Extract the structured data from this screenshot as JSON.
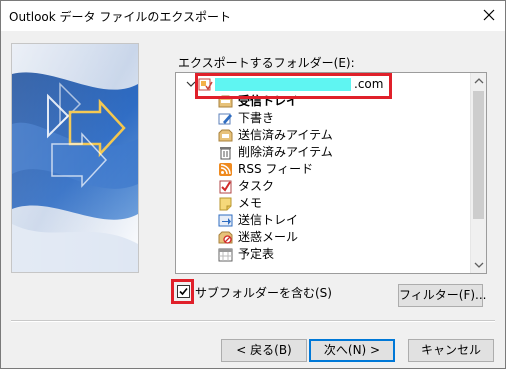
{
  "window": {
    "title": "Outlook データ ファイルのエクスポート"
  },
  "tree": {
    "label": "エクスポートするフォルダー(E):",
    "account_suffix": ".com",
    "items": [
      {
        "label": "受信トレイ",
        "icon": "inbox-icon",
        "bold": true
      },
      {
        "label": "下書き",
        "icon": "drafts-icon",
        "bold": false
      },
      {
        "label": "送信済みアイテム",
        "icon": "sent-items-icon",
        "bold": false
      },
      {
        "label": "削除済みアイテム",
        "icon": "trash-icon",
        "bold": false
      },
      {
        "label": "RSS フィード",
        "icon": "rss-icon",
        "bold": false
      },
      {
        "label": "タスク",
        "icon": "tasks-icon",
        "bold": false
      },
      {
        "label": "メモ",
        "icon": "notes-icon",
        "bold": false
      },
      {
        "label": "送信トレイ",
        "icon": "outbox-icon",
        "bold": false
      },
      {
        "label": "迷惑メール",
        "icon": "junk-mail-icon",
        "bold": false
      },
      {
        "label": "予定表",
        "icon": "calendar-icon",
        "bold": false
      }
    ]
  },
  "options": {
    "include_subfolders_label": "サブフォルダーを含む(S)",
    "include_subfolders_checked": true,
    "filter_button": "フィルター(F)..."
  },
  "footer": {
    "back_button": "< 戻る(B)",
    "next_button": "次へ(N) >",
    "cancel_button": "キャンセル"
  },
  "colors": {
    "highlight": "#e0202a",
    "redaction": "#5ff5f2",
    "default_button_border": "#0078d7"
  }
}
